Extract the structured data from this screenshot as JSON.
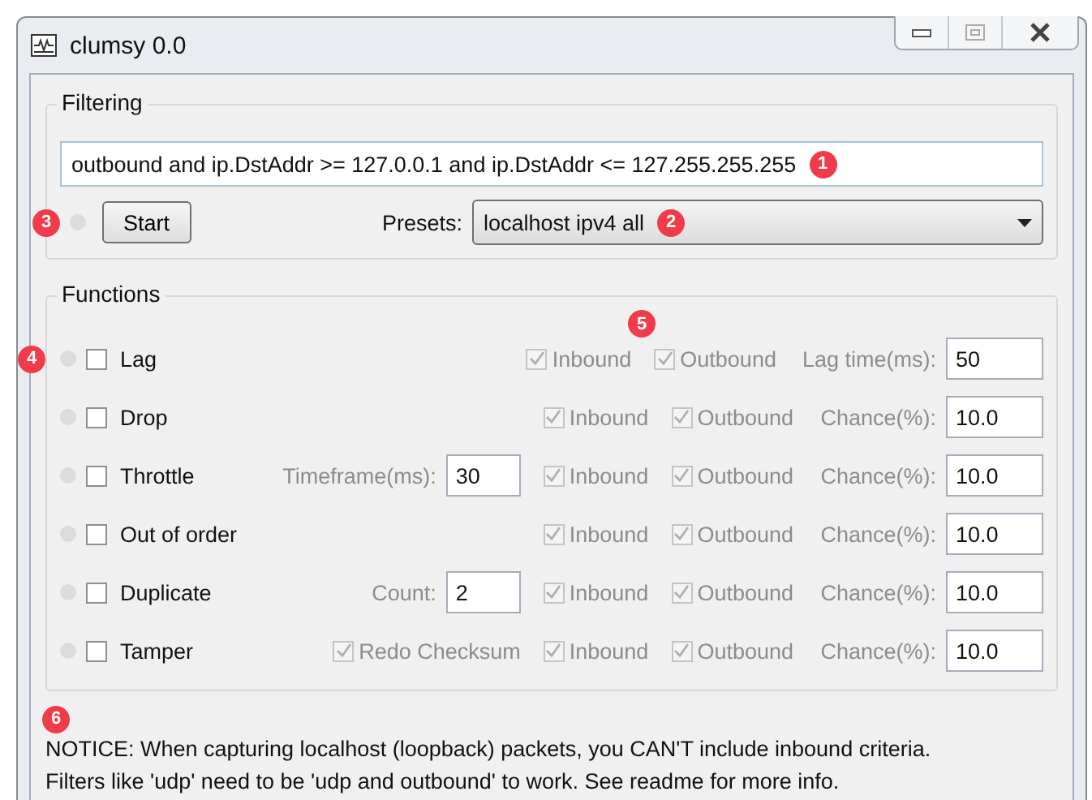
{
  "window": {
    "title": "clumsy 0.0"
  },
  "filtering": {
    "title": "Filtering",
    "filter": {
      "value": "outbound and ip.DstAddr >= 127.0.0.1 and ip.DstAddr <= 127.255.255.255",
      "badge": "1"
    },
    "start": {
      "label": "Start",
      "badge": "3"
    },
    "presets": {
      "label": "Presets:",
      "value": "localhost ipv4 all",
      "badge": "2"
    }
  },
  "functions": {
    "title": "Functions",
    "badge": "5",
    "rows": [
      {
        "name": "Lag",
        "badge": "4",
        "enabled": false,
        "inbound": true,
        "inbound_label": "Inbound",
        "outbound": true,
        "outbound_label": "Outbound",
        "param_label": "Lag time(ms):",
        "param_value": "50"
      },
      {
        "name": "Drop",
        "enabled": false,
        "inbound": true,
        "inbound_label": "Inbound",
        "outbound": true,
        "outbound_label": "Outbound",
        "param_label": "Chance(%):",
        "param_value": "10.0"
      },
      {
        "name": "Throttle",
        "enabled": false,
        "extra": {
          "kind": "field",
          "label": "Timeframe(ms):",
          "value": "30"
        },
        "inbound": true,
        "inbound_label": "Inbound",
        "outbound": true,
        "outbound_label": "Outbound",
        "param_label": "Chance(%):",
        "param_value": "10.0"
      },
      {
        "name": "Out of order",
        "enabled": false,
        "inbound": true,
        "inbound_label": "Inbound",
        "outbound": true,
        "outbound_label": "Outbound",
        "param_label": "Chance(%):",
        "param_value": "10.0"
      },
      {
        "name": "Duplicate",
        "enabled": false,
        "extra": {
          "kind": "field",
          "label": "Count:",
          "value": "2"
        },
        "inbound": true,
        "inbound_label": "Inbound",
        "outbound": true,
        "outbound_label": "Outbound",
        "param_label": "Chance(%):",
        "param_value": "10.0"
      },
      {
        "name": "Tamper",
        "enabled": false,
        "extra": {
          "kind": "checkbox",
          "label": "Redo Checksum",
          "checked": true
        },
        "inbound": true,
        "inbound_label": "Inbound",
        "outbound": true,
        "outbound_label": "Outbound",
        "param_label": "Chance(%):",
        "param_value": "10.0"
      }
    ]
  },
  "notice": {
    "badge": "6",
    "lines": [
      "NOTICE: When capturing localhost (loopback) packets, you CAN'T include inbound criteria.",
      "Filters like 'udp' need to be 'udp and outbound' to work. See readme for more info."
    ]
  }
}
